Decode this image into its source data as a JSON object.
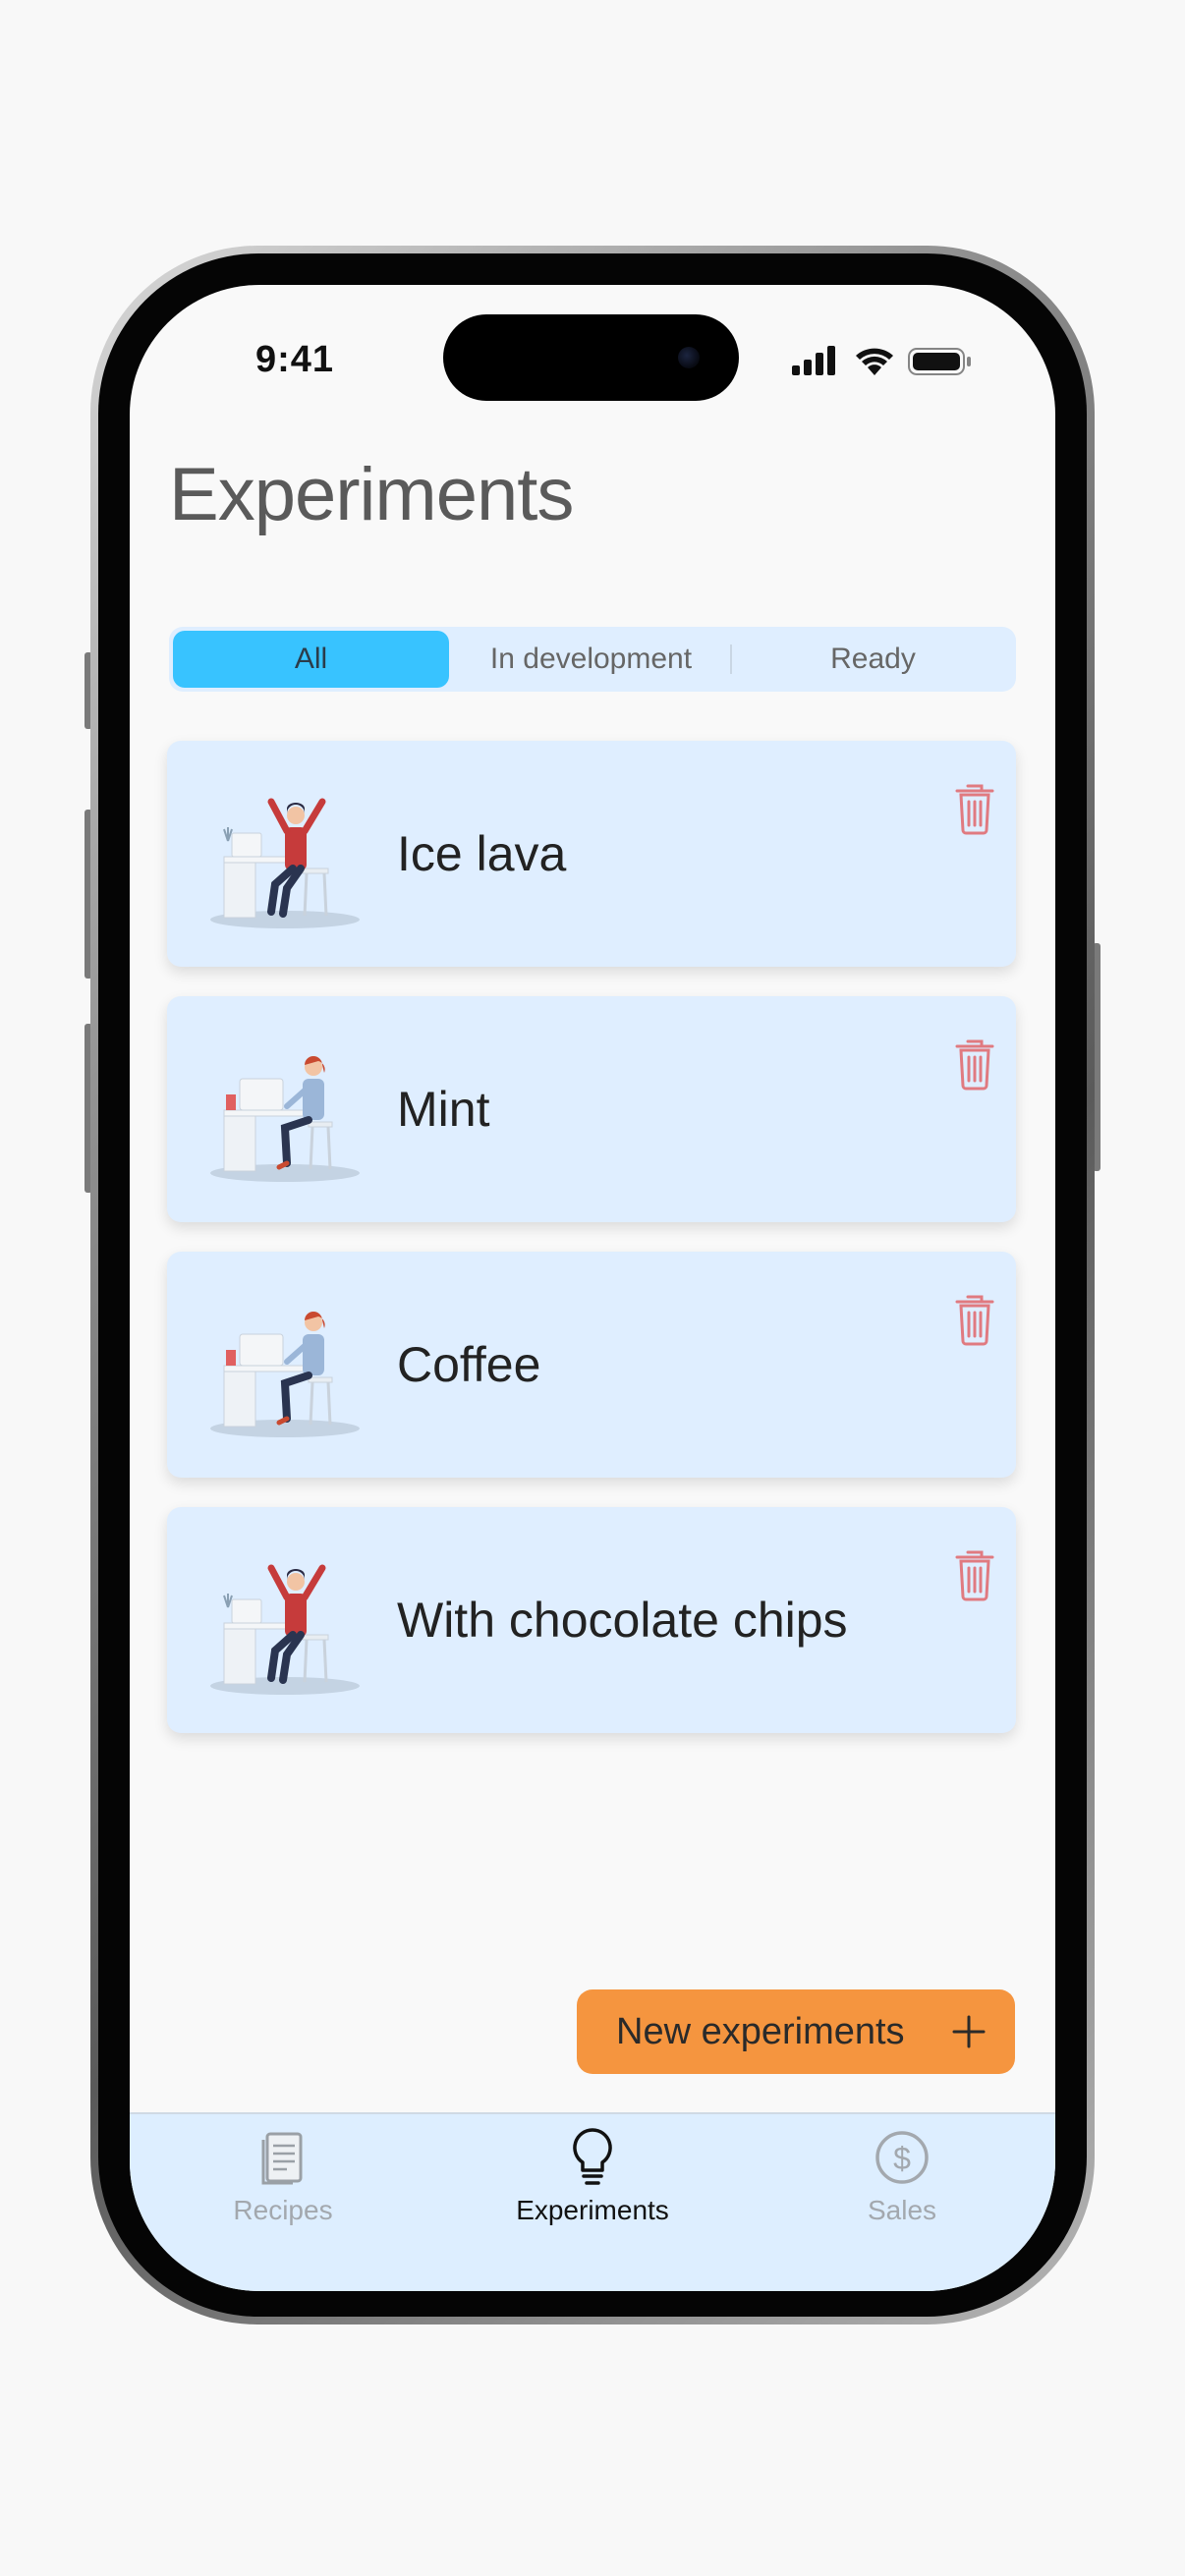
{
  "status_bar": {
    "time": "9:41"
  },
  "page": {
    "title": "Experiments"
  },
  "filter": {
    "segments": [
      "All",
      "In development",
      "Ready"
    ],
    "selected": "All"
  },
  "experiments": [
    {
      "name": "Ice lava",
      "illustration": "person-cheering-at-desk"
    },
    {
      "name": "Mint",
      "illustration": "person-working-at-desk"
    },
    {
      "name": "Coffee",
      "illustration": "person-working-at-desk"
    },
    {
      "name": "With chocolate chips",
      "illustration": "person-cheering-at-desk"
    }
  ],
  "actions": {
    "new_experiment": "New experiments"
  },
  "tabbar": {
    "items": [
      {
        "label": "Recipes",
        "icon": "recipe-book-icon",
        "active": false
      },
      {
        "label": "Experiments",
        "icon": "lightbulb-icon",
        "active": true
      },
      {
        "label": "Sales",
        "icon": "dollar-coin-icon",
        "active": false
      }
    ]
  },
  "colors": {
    "accent": "#38c3ff",
    "card_bg": "#dfeeff",
    "fab": "#f5953f",
    "delete": "#e07a80"
  }
}
